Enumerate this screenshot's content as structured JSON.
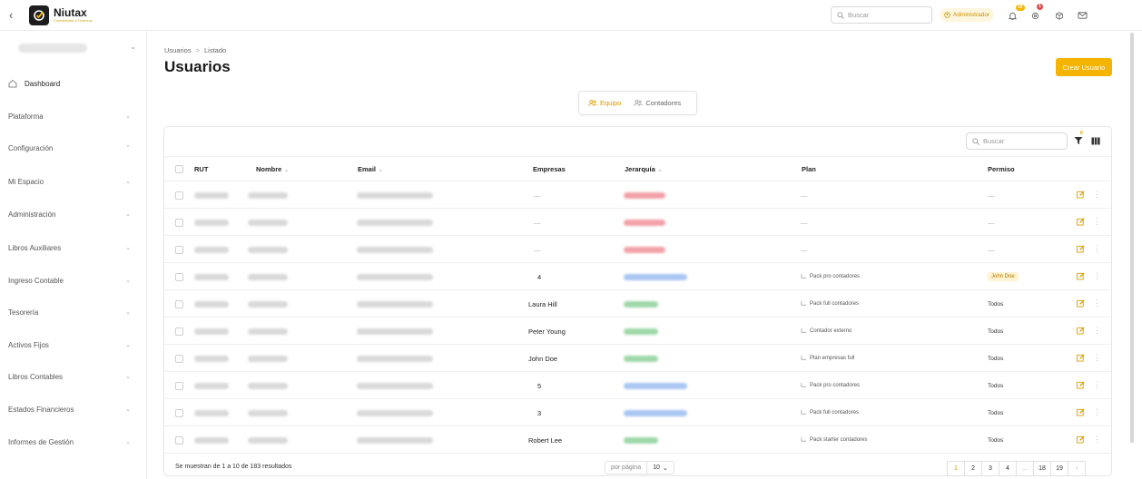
{
  "app": {
    "brand": "Niutax",
    "tagline": "Contabilidad y Finanzas"
  },
  "topbar": {
    "search_placeholder": "Buscar",
    "role": "Administrador",
    "notifications_count": "30",
    "alerts_count": "1"
  },
  "sidebar": {
    "items": [
      {
        "label": "Dashboard"
      },
      {
        "label": "Plataforma"
      },
      {
        "label": "Configuración"
      },
      {
        "label": "Mi Espacio"
      },
      {
        "label": "Administración"
      },
      {
        "label": "Libros Auxiliares"
      },
      {
        "label": "Ingreso Contable"
      },
      {
        "label": "Tesorería"
      },
      {
        "label": "Activos Fijos"
      },
      {
        "label": "Libros Contables"
      },
      {
        "label": "Estados Financieros"
      },
      {
        "label": "Informes de Gestión"
      }
    ]
  },
  "page": {
    "breadcrumb_root": "Usuarios",
    "breadcrumb_sep": ">",
    "breadcrumb_current": "Listado",
    "title": "Usuarios",
    "create_button": "Crear Usuario"
  },
  "tabs": {
    "equipo": "Equipo",
    "contadores": "Contadores"
  },
  "table": {
    "search_placeholder": "Buscar",
    "filter_count": "0",
    "headers": {
      "rut": "RUT",
      "nombre": "Nombre",
      "email": "Email",
      "empresas": "Empresas",
      "jerarquia": "Jerarquía",
      "plan": "Plan",
      "permiso": "Permiso"
    },
    "rows": [
      {
        "empresas": "—",
        "plan": "—",
        "permiso": "—",
        "jer_color": "#f2a1a8"
      },
      {
        "empresas": "—",
        "plan": "—",
        "permiso": "—",
        "jer_color": "#f2a1a8"
      },
      {
        "empresas": "—",
        "plan": "—",
        "permiso": "—",
        "jer_color": "#f2a1a8"
      },
      {
        "empresas": "4",
        "plan": "Pack pro contadores",
        "permiso": "John Doe",
        "jer_color": "#a9c6f2"
      },
      {
        "empresas": "Laura Hill",
        "plan": "Pack full contadores",
        "permiso": "Todos",
        "jer_color": "#9fd8a9"
      },
      {
        "empresas": "Peter Young",
        "plan": "Contador externo",
        "permiso": "Todos",
        "jer_color": "#9fd8a9"
      },
      {
        "empresas": "John Doe",
        "plan": "Plan empresas full",
        "permiso": "Todos",
        "jer_color": "#9fd8a9"
      },
      {
        "empresas": "5",
        "plan": "Pack pro contadores",
        "permiso": "Todos",
        "jer_color": "#a9c6f2"
      },
      {
        "empresas": "3",
        "plan": "Pack full contadores",
        "permiso": "Todos",
        "jer_color": "#a9c6f2"
      },
      {
        "empresas": "Robert Lee",
        "plan": "Pack starter contadores",
        "permiso": "Todos",
        "jer_color": "#9fd8a9"
      }
    ]
  },
  "footer": {
    "results": "Se muestran de 1 a 10 de 183 resultados",
    "per_page_label": "por página",
    "per_page_value": "10",
    "pages": [
      "1",
      "2",
      "3",
      "4",
      "...",
      "18",
      "19"
    ]
  },
  "colors": {
    "accent": "#f5b400",
    "accent_text": "#d89a00"
  }
}
